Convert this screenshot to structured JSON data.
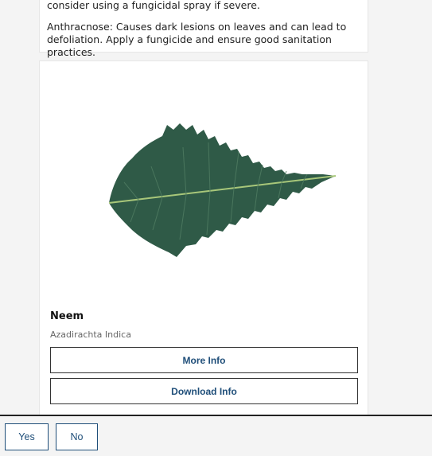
{
  "chat": {
    "treatment_text_partial": "consider using a fungicidal spray if severe.",
    "anthracnose_text": "Anthracnose: Causes dark lesions on leaves and can lead to defoliation. Apply a fungicide and ensure good sanitation practices."
  },
  "plant_card": {
    "name": "Neem",
    "scientific_name": "Azadirachta Indica",
    "image_icon": "neem-leaf-image",
    "more_info_label": "More Info",
    "download_info_label": "Download Info"
  },
  "quick_replies": {
    "yes_label": "Yes",
    "no_label": "No"
  },
  "colors": {
    "button_text": "#1f4e79",
    "leaf": "#2f5a47",
    "background": "#f4f4f4"
  }
}
